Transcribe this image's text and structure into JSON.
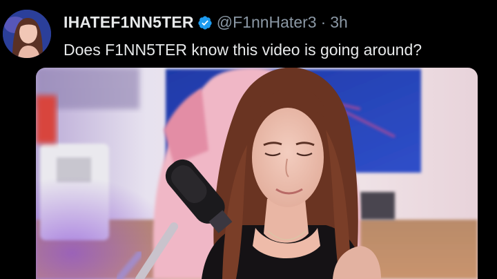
{
  "tweet": {
    "display_name": "IHATEF1NN5TER",
    "handle": "@F1nnHater3",
    "separator": "·",
    "time": "3h",
    "text": "Does F1NN5TER know this video is going around?",
    "verified_icon": "verified-badge-icon",
    "colors": {
      "background": "#000000",
      "text": "#e7e9ea",
      "secondary_text": "#8b98a5",
      "verified_blue": "#1d9bf0"
    }
  },
  "media": {
    "type": "video-still"
  }
}
